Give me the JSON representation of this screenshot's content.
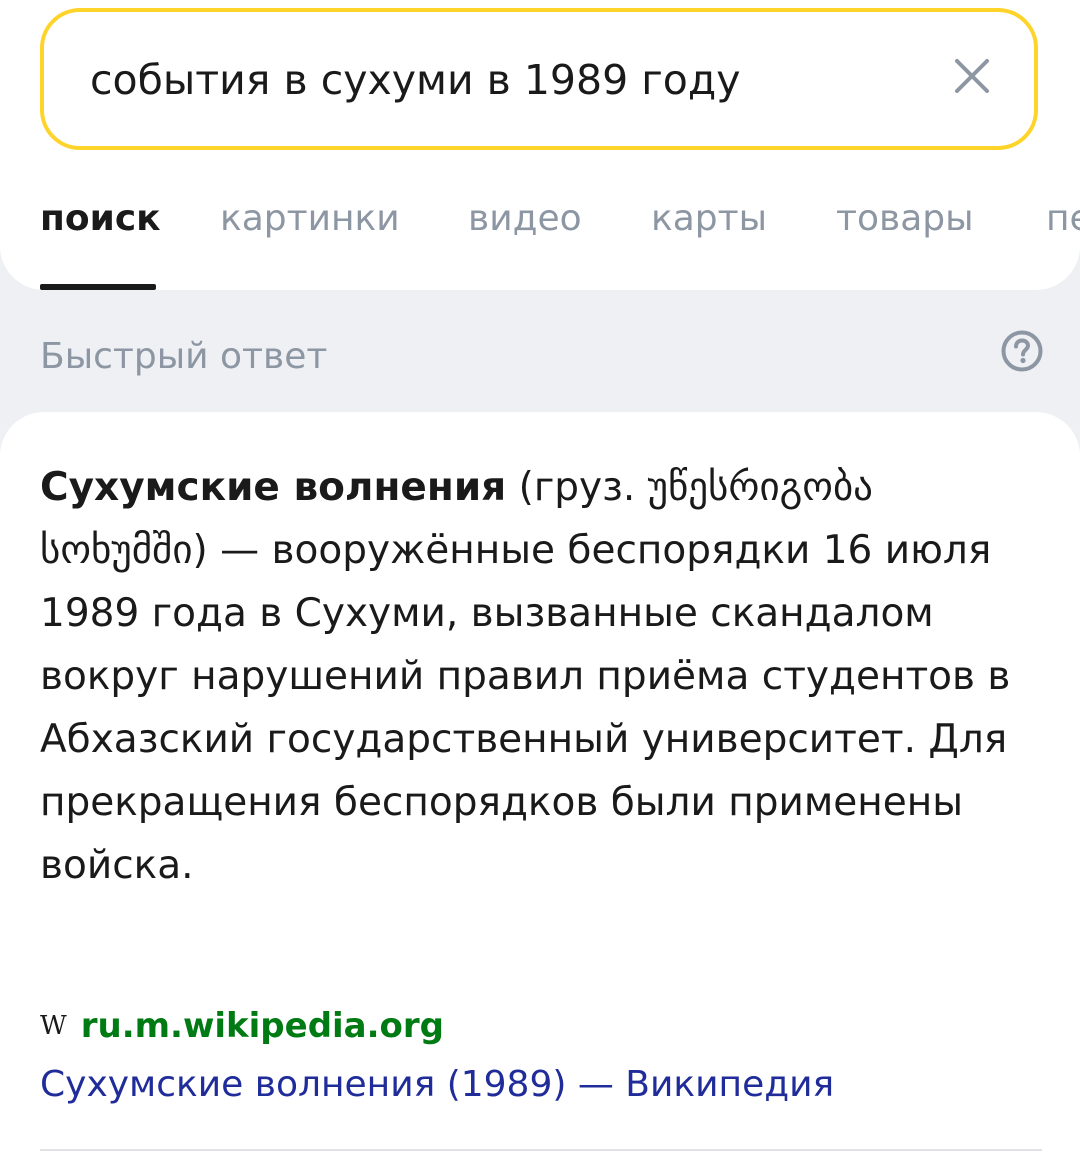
{
  "search": {
    "query": "события в сухуми в 1989 году",
    "clear_icon": "close-icon",
    "accent_color": "#fed42b"
  },
  "tabs": [
    {
      "label": "поиск",
      "active": true
    },
    {
      "label": "картинки",
      "active": false
    },
    {
      "label": "видео",
      "active": false
    },
    {
      "label": "карты",
      "active": false
    },
    {
      "label": "товары",
      "active": false
    },
    {
      "label": "пе",
      "active": false
    }
  ],
  "quick_answer": {
    "title": "Быстрый ответ",
    "help_icon": "question-circle-icon",
    "term": "Сухумские волнения",
    "description": " (груз. უწესრიგობა სოხუმში) — вооружённые беспорядки 16 июля 1989 года в Сухуми, вызванные скандалом вокруг нарушений правил приёма студентов в Абхазский государственный университет. Для прекращения беспорядков были применены войска.",
    "source_icon": "wikipedia-icon",
    "source_icon_glyph": "W",
    "source_domain": "ru.m.wikipedia.org",
    "source_title": "Сухумские волнения (1989) — Википедия",
    "colors": {
      "domain": "#007a12",
      "link": "#1f2c99"
    }
  }
}
